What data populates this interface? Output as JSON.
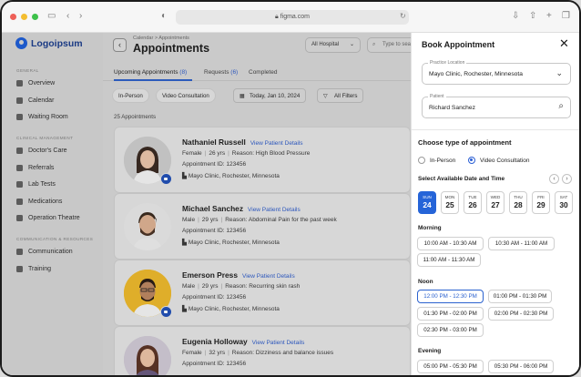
{
  "browser": {
    "url": "figma.com"
  },
  "brand": {
    "name": "Logoipsum"
  },
  "sidebar": {
    "sections": [
      {
        "title": "GENERAL",
        "items": [
          {
            "label": "Overview",
            "icon": "grid-icon"
          },
          {
            "label": "Calendar",
            "icon": "calendar-icon"
          },
          {
            "label": "Waiting Room",
            "icon": "room-icon"
          }
        ]
      },
      {
        "title": "CLINICAL MANAGEMENT",
        "items": [
          {
            "label": "Doctor's Care",
            "icon": "doctor-icon"
          },
          {
            "label": "Referrals",
            "icon": "referral-icon"
          },
          {
            "label": "Lab Tests",
            "icon": "flask-icon"
          },
          {
            "label": "Medications",
            "icon": "pill-icon"
          },
          {
            "label": "Operation Theatre",
            "icon": "scissors-icon"
          }
        ]
      },
      {
        "title": "COMMUNICATION & RESOURCES",
        "items": [
          {
            "label": "Communication",
            "icon": "chat-icon"
          },
          {
            "label": "Training",
            "icon": "book-icon"
          }
        ]
      }
    ]
  },
  "page": {
    "breadcrumb": "Calendar  >  Appointments",
    "title": "Appointments",
    "hospital_filter": "All Hospital",
    "search_placeholder": "Type to search",
    "tabs": [
      {
        "label": "Upcoming Appointments",
        "count": "(8)"
      },
      {
        "label": "Requests",
        "count": "(6)"
      },
      {
        "label": "Completed",
        "count": ""
      }
    ],
    "chips": {
      "in_person": "In-Person",
      "video": "Video Consultation",
      "date": "Today, Jan 10, 2024",
      "filters": "All Filters"
    },
    "count_label": "25 Appointments",
    "link_label": "View Patient Details",
    "patients": [
      {
        "name": "Nathaniel Russell",
        "gender": "Female",
        "age": "26 yrs",
        "reason": "Reason: High Blood Pressure",
        "appt_id": "Appointment ID: 123456",
        "location": "Mayo Clinic, Rochester, Minnesota"
      },
      {
        "name": "Michael Sanchez",
        "gender": "Male",
        "age": "29 yrs",
        "reason": "Reason: Abdominal Pain for the past week",
        "appt_id": "Appointment ID: 123456",
        "location": "Mayo Clinic, Rochester, Minnesota"
      },
      {
        "name": "Emerson Press",
        "gender": "Male",
        "age": "29 yrs",
        "reason": "Reason: Recurring skin rash",
        "appt_id": "Appointment ID: 123456",
        "location": "Mayo Clinic, Rochester, Minnesota"
      },
      {
        "name": "Eugenia Holloway",
        "gender": "Female",
        "age": "32 yrs",
        "reason": "Reason: Dizziness and balance issues",
        "appt_id": "Appointment ID: 123456",
        "location": ""
      }
    ]
  },
  "panel": {
    "title": "Book Appointment",
    "practice_label": "Practice Location",
    "practice_value": "Mayo Clinic, Rochester, Minnesota",
    "patient_label": "Patient",
    "patient_value": "Richard Sanchez",
    "type_heading": "Choose type of appointment",
    "type_options": [
      "In-Person",
      "Video Consultation"
    ],
    "type_selected": "Video Consultation",
    "date_heading": "Select Available Date and Time",
    "days": [
      {
        "dow": "SUN",
        "num": "24"
      },
      {
        "dow": "MON",
        "num": "25"
      },
      {
        "dow": "TUE",
        "num": "26"
      },
      {
        "dow": "WED",
        "num": "27"
      },
      {
        "dow": "THU",
        "num": "28"
      },
      {
        "dow": "FRI",
        "num": "29"
      },
      {
        "dow": "SAT",
        "num": "30"
      }
    ],
    "selected_day": "24",
    "morning_label": "Morning",
    "morning_slots": [
      "10:00 AM - 10:30 AM",
      "10:30 AM - 11:00 AM",
      "11:00 AM - 11:30 AM"
    ],
    "noon_label": "Noon",
    "noon_slots": [
      "12:00 PM - 12:30 PM",
      "01:00 PM - 01:30 PM",
      "01:30 PM - 02:00 PM",
      "02:00 PM - 02:30 PM",
      "02:30 PM - 03:00 PM"
    ],
    "selected_slot": "12:00 PM - 12:30 PM",
    "evening_label": "Evening",
    "evening_slots": [
      "05:00 PM - 05:30 PM",
      "05:30 PM - 06:00 PM"
    ]
  },
  "colors": {
    "accent": "#2564d8",
    "link": "#2f5bc4",
    "video_badge": "#2250b4"
  }
}
